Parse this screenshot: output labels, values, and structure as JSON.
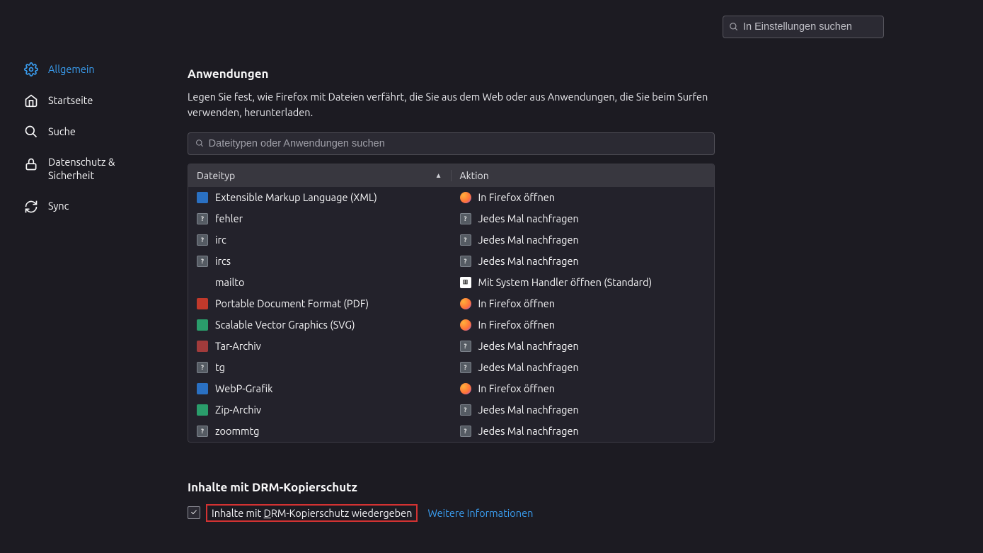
{
  "search": {
    "placeholder": "In Einstellungen suchen"
  },
  "sidebar": {
    "items": [
      {
        "label": "Allgemein"
      },
      {
        "label": "Startseite"
      },
      {
        "label": "Suche"
      },
      {
        "label": "Datenschutz & Sicherheit"
      },
      {
        "label": "Sync"
      }
    ]
  },
  "applications": {
    "title": "Anwendungen",
    "desc": "Legen Sie fest, wie Firefox mit Dateien verfährt, die Sie aus dem Web oder aus Anwendungen, die Sie beim Surfen verwenden, herunterladen.",
    "search_placeholder": "Dateitypen oder Anwendungen suchen",
    "col_type": "Dateityp",
    "col_action": "Aktion",
    "rows": [
      {
        "type": "Extensible Markup Language (XML)",
        "type_icon": "ico-blue",
        "action": "In Firefox öffnen",
        "action_icon": "ico-ff"
      },
      {
        "type": "fehler",
        "type_icon": "ico-grey",
        "action": "Jedes Mal nachfragen",
        "action_icon": "ico-grey"
      },
      {
        "type": "irc",
        "type_icon": "ico-grey",
        "action": "Jedes Mal nachfragen",
        "action_icon": "ico-grey"
      },
      {
        "type": "ircs",
        "type_icon": "ico-grey",
        "action": "Jedes Mal nachfragen",
        "action_icon": "ico-grey"
      },
      {
        "type": "mailto",
        "type_icon": "ico-none",
        "action": "Mit System Handler öffnen (Standard)",
        "action_icon": "ico-win"
      },
      {
        "type": "Portable Document Format (PDF)",
        "type_icon": "ico-red",
        "action": "In Firefox öffnen",
        "action_icon": "ico-ff"
      },
      {
        "type": "Scalable Vector Graphics (SVG)",
        "type_icon": "ico-green",
        "action": "In Firefox öffnen",
        "action_icon": "ico-ff"
      },
      {
        "type": "Tar-Archiv",
        "type_icon": "ico-dred",
        "action": "Jedes Mal nachfragen",
        "action_icon": "ico-grey"
      },
      {
        "type": "tg",
        "type_icon": "ico-grey",
        "action": "Jedes Mal nachfragen",
        "action_icon": "ico-grey"
      },
      {
        "type": "WebP-Grafik",
        "type_icon": "ico-blue",
        "action": "In Firefox öffnen",
        "action_icon": "ico-ff"
      },
      {
        "type": "Zip-Archiv",
        "type_icon": "ico-green",
        "action": "Jedes Mal nachfragen",
        "action_icon": "ico-grey"
      },
      {
        "type": "zoommtg",
        "type_icon": "ico-grey",
        "action": "Jedes Mal nachfragen",
        "action_icon": "ico-grey"
      }
    ]
  },
  "drm": {
    "title": "Inhalte mit DRM-Kopierschutz",
    "label_pre": "Inhalte mit ",
    "label_u": "D",
    "label_post": "RM-Kopierschutz wiedergeben",
    "more": "Weitere Informationen",
    "checked": true
  }
}
